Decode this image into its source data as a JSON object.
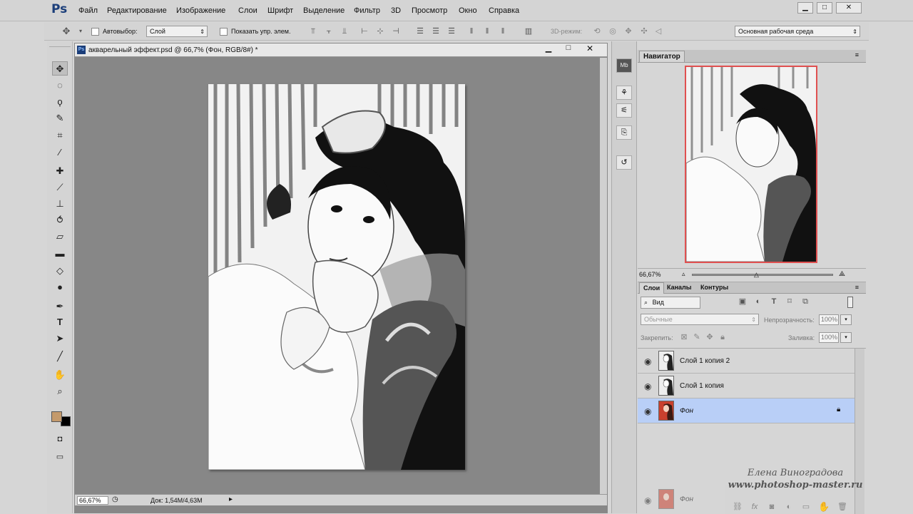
{
  "menubar": {
    "logo": "Ps",
    "items": [
      "Файл",
      "Редактирование",
      "Изображение",
      "Слои",
      "Шрифт",
      "Выделение",
      "Фильтр",
      "3D",
      "Просмотр",
      "Окно",
      "Справка"
    ]
  },
  "options": {
    "autoselect_label": "Автовыбор:",
    "autoselect_value": "Слой",
    "show_controls_label": "Показать упр. элем.",
    "mode3d_label": "3D-режим:",
    "workspace": "Основная рабочая среда"
  },
  "document": {
    "title": "акварельный эффект.psd @ 66,7% (Фон, RGB/8#) *",
    "zoom": "66,67%",
    "doc_info": "Док: 1,54M/4,63M"
  },
  "navigator": {
    "tab": "Навигатор",
    "zoom": "66,67%"
  },
  "layers": {
    "tabs": [
      "Слои",
      "Каналы",
      "Контуры"
    ],
    "filter": "Вид",
    "blend_mode": "Обычные",
    "opacity_label": "Непрозрачность:",
    "opacity": "100%",
    "lock_label": "Закрепить:",
    "fill_label": "Заливка:",
    "fill": "100%",
    "items": [
      {
        "name": "Слой 1 копия 2",
        "selected": false
      },
      {
        "name": "Слой 1 копия",
        "selected": false
      },
      {
        "name": "Фон",
        "selected": true
      }
    ],
    "ghost_name": "Фон"
  },
  "watermark": {
    "line1": "Елена Виноградова",
    "line2": "www.photoshop-master.ru"
  },
  "colors": {
    "foreground": "#c49a6c",
    "background": "#000000",
    "selected_layer": "#b9cff7"
  }
}
